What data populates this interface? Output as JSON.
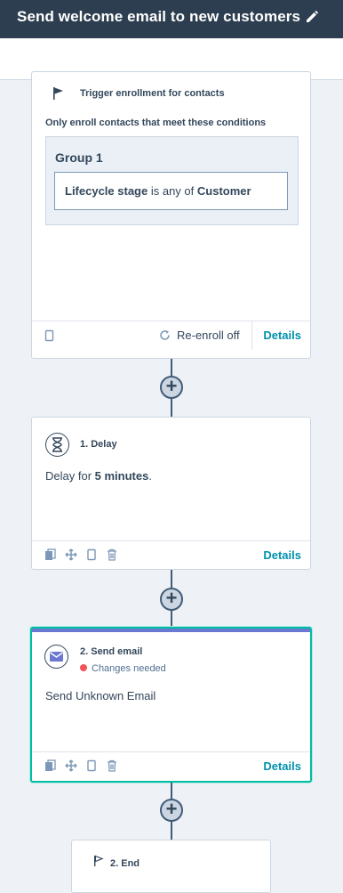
{
  "header": {
    "title": "Send welcome email to new customers"
  },
  "trigger": {
    "title": "Trigger enrollment for contacts",
    "subtitle": "Only enroll contacts that meet these conditions",
    "group_label": "Group 1",
    "condition": {
      "property": "Lifecycle stage",
      "operator": "is any of",
      "value": "Customer"
    },
    "reenroll": "Re-enroll off",
    "details": "Details"
  },
  "steps": [
    {
      "title": "1. Delay",
      "body_prefix": "Delay for",
      "body_value": "5 minutes",
      "body_suffix": ".",
      "details": "Details"
    },
    {
      "title": "2. Send email",
      "status": "Changes needed",
      "status_color": "#f2545b",
      "body": "Send Unknown Email",
      "details": "Details"
    }
  ],
  "end": {
    "title": "2. End"
  },
  "icons": [
    "flag-icon",
    "edit-pencil-icon",
    "copy-icon",
    "move-icon",
    "clone-icon",
    "delete-icon",
    "hourglass-icon",
    "email-icon",
    "refresh-icon",
    "plus-icon"
  ]
}
